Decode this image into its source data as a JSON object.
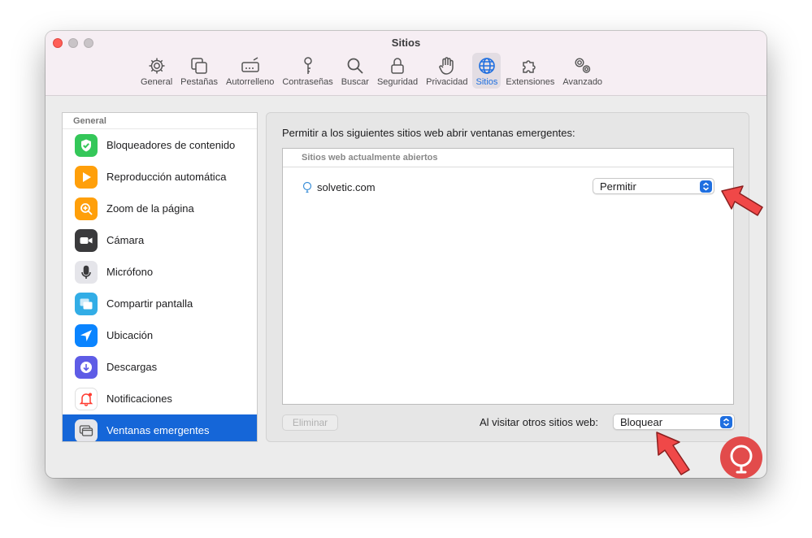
{
  "window": {
    "title": "Sitios"
  },
  "toolbar": {
    "items": [
      {
        "label": "General",
        "icon": "gear-icon"
      },
      {
        "label": "Pestañas",
        "icon": "tabs-icon"
      },
      {
        "label": "Autorrelleno",
        "icon": "autofill-icon"
      },
      {
        "label": "Contraseñas",
        "icon": "key-icon"
      },
      {
        "label": "Buscar",
        "icon": "search-icon"
      },
      {
        "label": "Seguridad",
        "icon": "lock-icon"
      },
      {
        "label": "Privacidad",
        "icon": "hand-icon"
      },
      {
        "label": "Sitios",
        "icon": "globe-icon",
        "active": true
      },
      {
        "label": "Extensiones",
        "icon": "puzzle-icon"
      },
      {
        "label": "Avanzado",
        "icon": "gears-icon"
      }
    ],
    "accent": "#1f6fe0"
  },
  "sidebar": {
    "header": "General",
    "items": [
      {
        "label": "Bloqueadores de contenido",
        "icon": "shield-check-icon",
        "color": "#34c759"
      },
      {
        "label": "Reproducción automática",
        "icon": "play-icon",
        "color": "#ff9f0a"
      },
      {
        "label": "Zoom de la página",
        "icon": "zoom-icon",
        "color": "#ff9f0a"
      },
      {
        "label": "Cámara",
        "icon": "camera-icon",
        "color": "#3a3a3c"
      },
      {
        "label": "Micrófono",
        "icon": "microphone-icon",
        "color": "#8e8e93"
      },
      {
        "label": "Compartir pantalla",
        "icon": "screen-share-icon",
        "color": "#32ade6"
      },
      {
        "label": "Ubicación",
        "icon": "location-icon",
        "color": "#0a84ff"
      },
      {
        "label": "Descargas",
        "icon": "download-icon",
        "color": "#5e5ce6"
      },
      {
        "label": "Notificaciones",
        "icon": "bell-icon",
        "color": "#ff3b30"
      },
      {
        "label": "Ventanas emergentes",
        "icon": "popup-window-icon",
        "color": "#8e8e93",
        "selected": true
      }
    ],
    "selected_color": "#1566d8"
  },
  "panel": {
    "title": "Permitir a los siguientes sitios web abrir ventanas emergentes:",
    "table_header": "Sitios web actualmente abiertos",
    "sites": [
      {
        "name": "solvetic.com",
        "setting": "Permitir"
      }
    ],
    "remove_button": "Eliminar",
    "other_sites_label": "Al visitar otros sitios web:",
    "other_sites_value": "Bloquear"
  },
  "annotations": {
    "arrow_color": "#f04848"
  }
}
